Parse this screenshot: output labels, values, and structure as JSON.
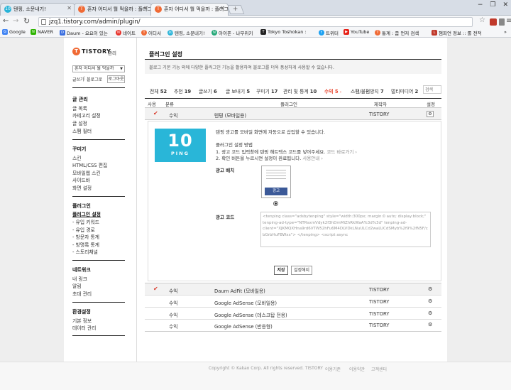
{
  "browser": {
    "tabs": [
      {
        "title": "텐핑, 소문내기!",
        "color": "#27b3d8",
        "icon": "10"
      },
      {
        "title": "혼자 어디서 뭘 먹을까 : 플러그인",
        "color": "#f06a35",
        "icon": "T"
      },
      {
        "title": "혼자 어디서 뭘 먹을까 : 플러그인",
        "color": "#f06a35",
        "icon": "T"
      }
    ],
    "new_tab": "+",
    "url": "jzq1.tistory.com/admin/plugin/",
    "bookmarks": [
      {
        "label": "Google",
        "color": "#4285f4",
        "icon": "G"
      },
      {
        "label": "NAVER",
        "color": "#2db400",
        "icon": "N"
      },
      {
        "label": "Daum - 요요이 있는",
        "color": "#3b6fe0",
        "icon": "D"
      },
      {
        "label": "네이트",
        "color": "#e8322b",
        "icon": "N"
      },
      {
        "label": "어디서",
        "color": "#f06a35",
        "icon": "T"
      },
      {
        "label": "텐핑, 소문내기!",
        "color": "#27b3d8",
        "icon": "10"
      },
      {
        "label": "아이폰 - 나무위키",
        "color": "#24a878",
        "icon": "N"
      },
      {
        "label": "Tokyo Toshokan : ",
        "color": "#222222",
        "icon": "T"
      },
      {
        "label": "트위터",
        "color": "#1da1f2",
        "icon": "t"
      },
      {
        "label": "YouTube",
        "color": "#e62117",
        "icon": "▶"
      },
      {
        "label": "통계 : 좀 먼저 검색",
        "color": "#f06a35",
        "icon": "T"
      },
      {
        "label": "챔피언 정보 :: 롤 전적",
        "color": "#c0392b",
        "icon": "L"
      }
    ],
    "bookmarks_more": "»"
  },
  "sidebar": {
    "logo": "TISTORY",
    "logo_sub": "관리",
    "blog_select": "혼자 어디서 뭘 먹을까",
    "links": [
      "글쓰기",
      "블로그로",
      "로그아웃"
    ],
    "sections": [
      {
        "title": "글 관리",
        "items": [
          "글 목록",
          "카테고리 설정",
          "글 설정",
          "스팸 필터"
        ]
      },
      {
        "title": "꾸미기",
        "items": [
          "스킨",
          "HTML/CSS 편집",
          "모바일웹 스킨",
          "사이드바",
          "화면 설정"
        ]
      },
      {
        "title": "플러그인",
        "items": [
          "플러그인 설정",
          "- 유입 키워드",
          "- 유입 경로",
          "- 방문자 통계",
          "- 방명록 통계",
          "- 스토리채널"
        ]
      },
      {
        "title": "네트워크",
        "items": [
          "내 링크",
          "알림",
          "초대 관리"
        ]
      },
      {
        "title": "환경설정",
        "items": [
          "기본 정보",
          "데이터 관리"
        ]
      }
    ]
  },
  "main": {
    "title": "플러그인 설정",
    "desc": "블로그 기본 기능 외에 다양한 플러그인 기능을 활용하여 블로그를 더욱 풍성하게 사용할 수 있습니다.",
    "filters": [
      {
        "label": "전체",
        "count": "52"
      },
      {
        "label": "추천",
        "count": "19"
      },
      {
        "label": "글쓰기",
        "count": "6"
      },
      {
        "label": "글 보내기",
        "count": "5"
      },
      {
        "label": "꾸미기",
        "count": "17"
      },
      {
        "label": "관리 및 통계",
        "count": "10"
      },
      {
        "label": "수익",
        "count": "5",
        "active": true
      },
      {
        "label": "스팸/불펌방지",
        "count": "7"
      },
      {
        "label": "멀티미디어",
        "count": "2"
      }
    ],
    "search_placeholder": "검색",
    "table_headers": [
      "사용",
      "분류",
      "플러그인",
      "제작자",
      "설정"
    ],
    "rows": [
      {
        "checked": true,
        "category": "수익",
        "name": "텐핑 (모바일용)",
        "maker": "TISTORY",
        "expanded": true
      },
      {
        "checked": true,
        "category": "수익",
        "name": "Daum AdFit (모바일용)",
        "maker": "TISTORY"
      },
      {
        "checked": false,
        "category": "수익",
        "name": "Google AdSense (모바일용)",
        "maker": "TISTORY"
      },
      {
        "checked": false,
        "category": "수익",
        "name": "Google AdSense (데스크탑 전용)",
        "maker": "TISTORY"
      },
      {
        "checked": false,
        "category": "수익",
        "name": "Google AdSense (반응형)",
        "maker": "TISTORY"
      }
    ],
    "detail": {
      "logo_text": "10",
      "logo_sub": "PING",
      "intro": "텐핑 광고를 모바일 화면에 자동으로 삽입할 수 있습니다.",
      "method_title": "플러그인 설정 방법",
      "step1": "1. 광고 코드 입력창에 텐핑 해트텍스 코드를 넣어주세요.",
      "step1_link": "코드 바로가기 ›",
      "step2": "2. 확인 버튼을 누르시면 설정이 완료됩니다.",
      "step2_link": "사용안내 ›",
      "ad_pos_label": "광고 배치",
      "ad_preview_label": "광고",
      "ad_code_label": "광고 코드",
      "ad_code": "<tenping class=\"adsbytenping\" style=\"width:300px; margin:0 auto; display:block;\" tenping-ad-type=\"NTRsxmVdyk2f3hDmMiZhRkWaA%3d%3d\" tenping-ad-client=\"XJKMQXHna9rd6VTW52hFu6M4DLVDkLNuULCd2waLUCdSMyb%2f9%2fN5F/cbGrbHuFBWxx\"> </tenping> <script async",
      "save": "저장",
      "reset": "설정해지"
    }
  },
  "footer": {
    "copyright": "Copyright © Kakao Corp. All rights reserved. TISTORY",
    "links": [
      "이용기준",
      "이용약관",
      "고객센터"
    ]
  }
}
